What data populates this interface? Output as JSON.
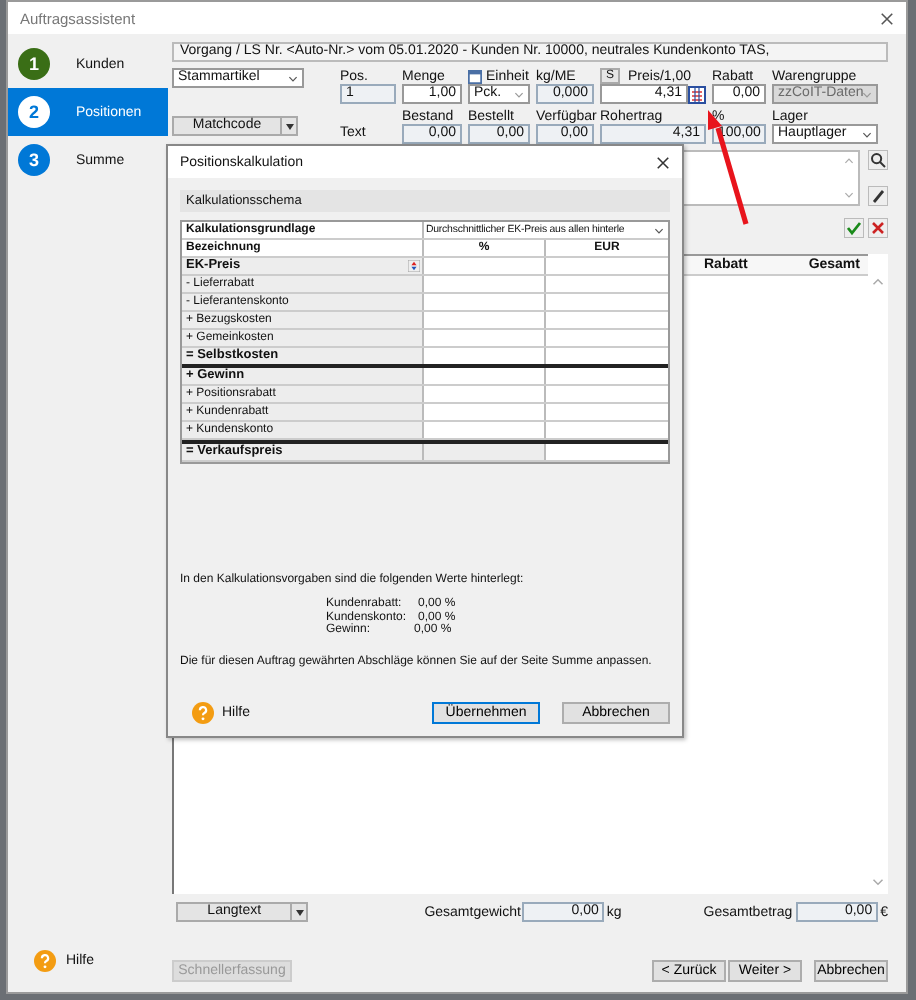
{
  "window": {
    "title": "Auftragsassistent"
  },
  "steps": [
    {
      "number": "1",
      "label": "Kunden",
      "selected": false,
      "color": "#3a6e16"
    },
    {
      "number": "2",
      "label": "Positionen",
      "selected": true,
      "color": "#0078d7"
    },
    {
      "number": "3",
      "label": "Summe",
      "selected": false,
      "color": "#0078d7"
    }
  ],
  "header_line": "Vorgang / LS Nr. <Auto-Nr.> vom 05.01.2020 - Kunden Nr. 10000, neutrales Kundenkonto TAS,",
  "article_source": "Stammartikel",
  "matchcode_button": "Matchcode",
  "price_toggle": "S",
  "fields_top": [
    {
      "label": "Pos.",
      "value": "1",
      "kind": "index"
    },
    {
      "label": "Menge",
      "value": "1,00",
      "kind": "input"
    },
    {
      "label": "Einheit",
      "value": "Pck.",
      "kind": "dropdown"
    },
    {
      "label": "kg/ME",
      "value": "0,000",
      "kind": "readonly"
    },
    {
      "label": "Preis/1,00",
      "value": "4,31",
      "kind": "input"
    },
    {
      "label": "Rabatt",
      "value": "0,00",
      "kind": "input"
    },
    {
      "label": "Warengruppe",
      "value": "zzCoIT-Daten",
      "kind": "disabled"
    }
  ],
  "fields_bottom": [
    {
      "label": "Bestand",
      "value": "0,00",
      "kind": "readonly"
    },
    {
      "label": "Bestellt",
      "value": "0,00",
      "kind": "readonly"
    },
    {
      "label": "Verfügbar",
      "value": "0,00",
      "kind": "readonly"
    },
    {
      "label": "Rohertrag",
      "value": "4,31",
      "kind": "readonly"
    },
    {
      "label": "%",
      "value": "100,00",
      "kind": "readonly"
    },
    {
      "label": "Lager",
      "value": "Hauptlager",
      "kind": "dropdown"
    }
  ],
  "text_label": "Text",
  "list_columns": [
    "Rabatt",
    "Gesamt"
  ],
  "longtext_button": "Langtext",
  "total_weight": {
    "label": "Gesamtgewicht",
    "value": "0,00",
    "unit": "kg"
  },
  "total_amount": {
    "label": "Gesamtbetrag",
    "value": "0,00",
    "unit": "€"
  },
  "help": "Hilfe",
  "quick_entry": {
    "label": "Schnellerfassung",
    "disabled": true
  },
  "nav_buttons": [
    "< Zurück",
    "Weiter >",
    "Abbrechen"
  ],
  "dialog": {
    "title": "Positionskalkulation",
    "group": "Kalkulationsschema",
    "basis": {
      "label": "Kalkulationsgrundlage",
      "value": "Durchschnittlicher EK-Preis aus allen hinterle"
    },
    "columns": [
      "Bezeichnung",
      "%",
      "EUR"
    ],
    "rows": [
      {
        "label": "EK-Preis",
        "kind": "base"
      },
      {
        "label": "- Lieferrabatt",
        "kind": "item"
      },
      {
        "label": "- Lieferantenskonto",
        "kind": "item"
      },
      {
        "label": "+ Bezugskosten",
        "kind": "item"
      },
      {
        "label": "+ Gemeinkosten",
        "kind": "item"
      },
      {
        "label": "= Selbstkosten",
        "kind": "subtotal"
      },
      {
        "label": "+ Gewinn",
        "kind": "group"
      },
      {
        "label": "+ Positionsrabatt",
        "kind": "item"
      },
      {
        "label": "+ Kundenrabatt",
        "kind": "item"
      },
      {
        "label": "+ Kundenskonto",
        "kind": "item"
      },
      {
        "label": "= Verkaufspreis",
        "kind": "total"
      }
    ],
    "note": "In den Kalkulationsvorgaben sind die folgenden Werte hinterlegt:",
    "defaults": [
      {
        "label": "Kundenrabatt:",
        "value": "0,00 %"
      },
      {
        "label": "Kundenskonto:",
        "value": "0,00 %"
      },
      {
        "label": "Gewinn:",
        "value": "0,00 %"
      }
    ],
    "hint": "Die für diesen Auftrag gewährten Abschläge können Sie auf der Seite Summe anpassen.",
    "help": "Hilfe",
    "buttons": [
      {
        "label": "Übernehmen",
        "default": true
      },
      {
        "label": "Abbrechen",
        "default": false
      }
    ]
  }
}
